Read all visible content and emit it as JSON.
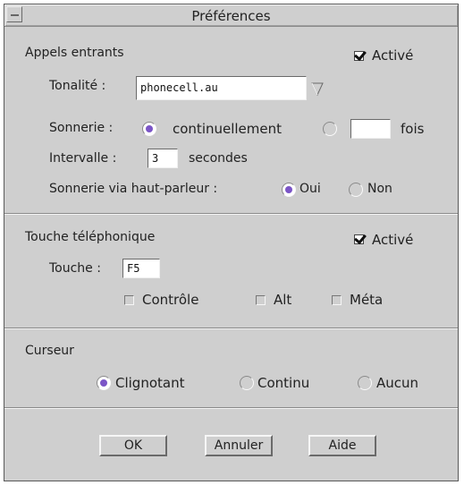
{
  "window": {
    "title": "Préférences"
  },
  "incoming": {
    "heading": "Appels entrants",
    "enabled_label": "Activé",
    "enabled": true,
    "ringtone_label": "Tonalité :",
    "ringtone_value": "phonecell.au",
    "ring_label": "Sonnerie :",
    "ring_continuous_label": "continuellement",
    "ring_times_value": "",
    "ring_times_label": "fois",
    "ring_mode_selected": "continuellement",
    "interval_label": "Intervalle :",
    "interval_value": "3",
    "interval_unit": "secondes",
    "speaker_label": "Sonnerie via haut-parleur :",
    "speaker_yes": "Oui",
    "speaker_no": "Non",
    "speaker_selected": "Oui"
  },
  "hotkey": {
    "heading": "Touche téléphonique",
    "enabled_label": "Activé",
    "enabled": true,
    "key_label": "Touche :",
    "key_value": "F5",
    "mod_ctrl": "Contrôle",
    "mod_alt": "Alt",
    "mod_meta": "Méta"
  },
  "cursor": {
    "heading": "Curseur",
    "opt_blink": "Clignotant",
    "opt_steady": "Continu",
    "opt_none": "Aucun",
    "selected": "Clignotant"
  },
  "buttons": {
    "ok": "OK",
    "cancel": "Annuler",
    "help": "Aide"
  },
  "colors": {
    "accent": "#7b55c7",
    "background": "#cfcfcf"
  }
}
